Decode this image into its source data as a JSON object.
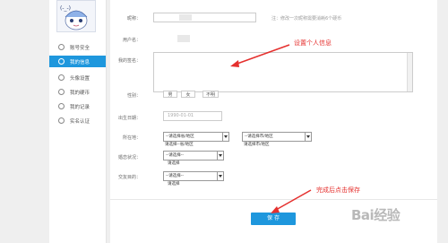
{
  "sidebar": {
    "items": [
      {
        "label": "账号安全",
        "icon": "shield-icon"
      },
      {
        "label": "我的信息",
        "icon": "user-icon",
        "active": true
      },
      {
        "label": "头像设置",
        "icon": "avatar-icon"
      },
      {
        "label": "我的硬币",
        "icon": "coin-icon"
      },
      {
        "label": "我的记录",
        "icon": "record-icon"
      },
      {
        "label": "实名认证",
        "icon": "id-card-icon"
      }
    ]
  },
  "form": {
    "nickname_label": "昵称：",
    "nickname_note": "注：修改一次昵称需要消耗6个硬币",
    "username_label": "用户名：",
    "signature_label": "我的签名：",
    "gender_label": "性别：",
    "gender_options": [
      "男",
      "女",
      "不明"
    ],
    "birthday_label": "出生日期：",
    "birthday_value": "1990-01-01",
    "location_label": "所在地：",
    "location_province": "--请选择省/地区",
    "location_province_sub": "请选择--省/地区",
    "location_city": "--请选择市/地区",
    "location_city_sub": "请选择市/地区",
    "marital_label": "婚恋状况：",
    "marital_value": "--请选择--",
    "marital_sub": "请选择",
    "purpose_label": "交友目的：",
    "purpose_value": "--请选择--",
    "purpose_sub": "请选择",
    "save_label": "保 存"
  },
  "annotations": {
    "signature_tip": "设置个人信息",
    "save_tip": "完成后点击保存"
  },
  "watermark": "Bai经验",
  "colors": {
    "accent": "#1e97dd",
    "annotation": "#e5302e"
  }
}
